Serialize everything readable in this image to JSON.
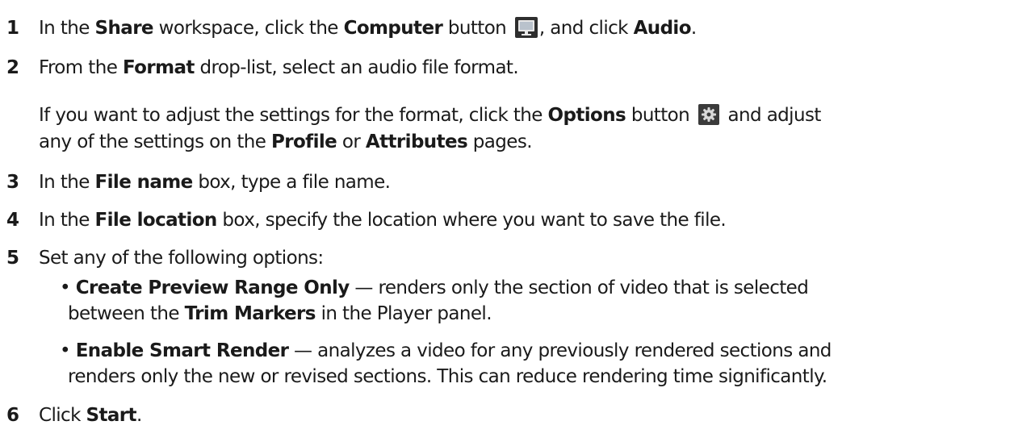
{
  "steps": [
    {
      "number": "1",
      "parts": {
        "p1": "In the ",
        "b1": "Share",
        "p2": " workspace, click the ",
        "b2": "Computer",
        "p3": " button ",
        "p4": ", and click ",
        "b3": "Audio",
        "p5": "."
      },
      "icon": "computer-icon"
    },
    {
      "number": "2",
      "parts": {
        "p1": "From the ",
        "b1": "Format",
        "p2": " drop-list, select an audio file format."
      },
      "note": {
        "line1": {
          "p1": "If you want to adjust the settings for the format, click the ",
          "b1": "Options",
          "p2": " button ",
          "p3": " and adjust"
        },
        "line2": {
          "p1": "any of the settings on the ",
          "b1": "Profile",
          "p2": " or ",
          "b2": "Attributes",
          "p3": " pages."
        },
        "icon": "gear-icon"
      }
    },
    {
      "number": "3",
      "parts": {
        "p1": "In the ",
        "b1": "File name",
        "p2": " box, type a file name."
      }
    },
    {
      "number": "4",
      "parts": {
        "p1": "In the ",
        "b1": "File location",
        "p2": " box, specify the location where you want to save the file."
      }
    },
    {
      "number": "5",
      "parts": {
        "p1": "Set any of the following options:"
      },
      "bullets": [
        {
          "marker": "•",
          "b1": "Create Preview Range Only",
          "p1": " — renders only the section of video that is selected",
          "cont": {
            "p1": "between the ",
            "b1": "Trim Markers",
            "p2": " in the Player panel."
          }
        },
        {
          "marker": "•",
          "b1": "Enable Smart Render",
          "p1": " — analyzes a video for any previously rendered sections and",
          "cont": {
            "p1": "renders only the new or revised sections. This can reduce rendering time significantly."
          }
        }
      ]
    },
    {
      "number": "6",
      "parts": {
        "p1": "Click ",
        "b1": "Start",
        "p2": "."
      }
    }
  ]
}
